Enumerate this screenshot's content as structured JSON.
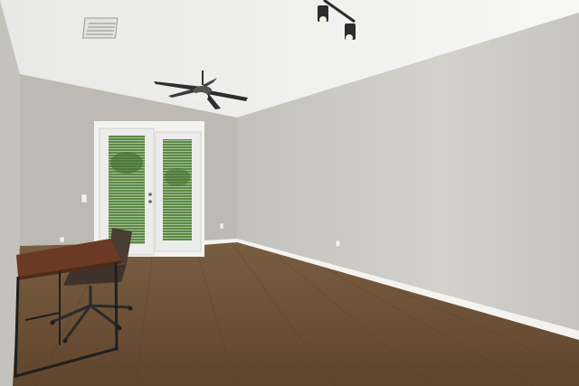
{
  "scene": {
    "type": "photo",
    "subject": "empty-room-interior",
    "colors": {
      "ceiling": "#f2f2f0",
      "wall_right": "#c9c7c1",
      "wall_back": "#bdbab3",
      "wall_left": "#c4c2bc",
      "baseboard": "#f4f3f0",
      "floor": "#6b5035",
      "door_frame": "#f3f3f1",
      "greenery": "#4f7a3a",
      "desk_top": "#6b3a25",
      "chair": "#4a3b33",
      "metal": "#2a2a2a"
    },
    "fixtures": [
      "ceiling-vent",
      "ceiling-fan",
      "track-light",
      "french-doors",
      "desk",
      "office-chair"
    ]
  }
}
